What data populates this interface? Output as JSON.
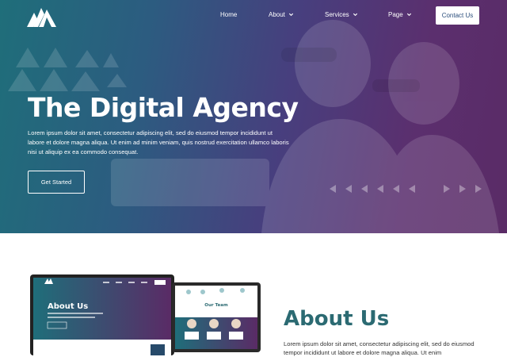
{
  "nav": {
    "items": [
      {
        "label": "Home",
        "dropdown": false
      },
      {
        "label": "About",
        "dropdown": true
      },
      {
        "label": "Services",
        "dropdown": true
      },
      {
        "label": "Page",
        "dropdown": true
      }
    ],
    "contact_label": "Contact Us"
  },
  "hero": {
    "title": "The Digital Agency",
    "text": "Lorem ipsum dolor sit amet, consectetur adipiscing elit, sed do eiusmod tempor incididunt ut labore et dolore magna aliqua. Ut enim ad minim veniam, quis nostrud exercitation ullamco laboris nisi ut aliquip ex ea commodo consequat.",
    "cta_label": "Get Started"
  },
  "about": {
    "title": "About Us",
    "text": "Lorem ipsum dolor sit amet, consectetur adipiscing elit, sed do eiusmod tempor incididunt ut labore et dolore magna aliqua. Ut enim",
    "mockup_heading": "About Us",
    "mockup_team_heading": "Our Team"
  },
  "colors": {
    "teal": "#1f6e7a",
    "purple": "#5a2b66",
    "heading_teal": "#2b6a72"
  }
}
